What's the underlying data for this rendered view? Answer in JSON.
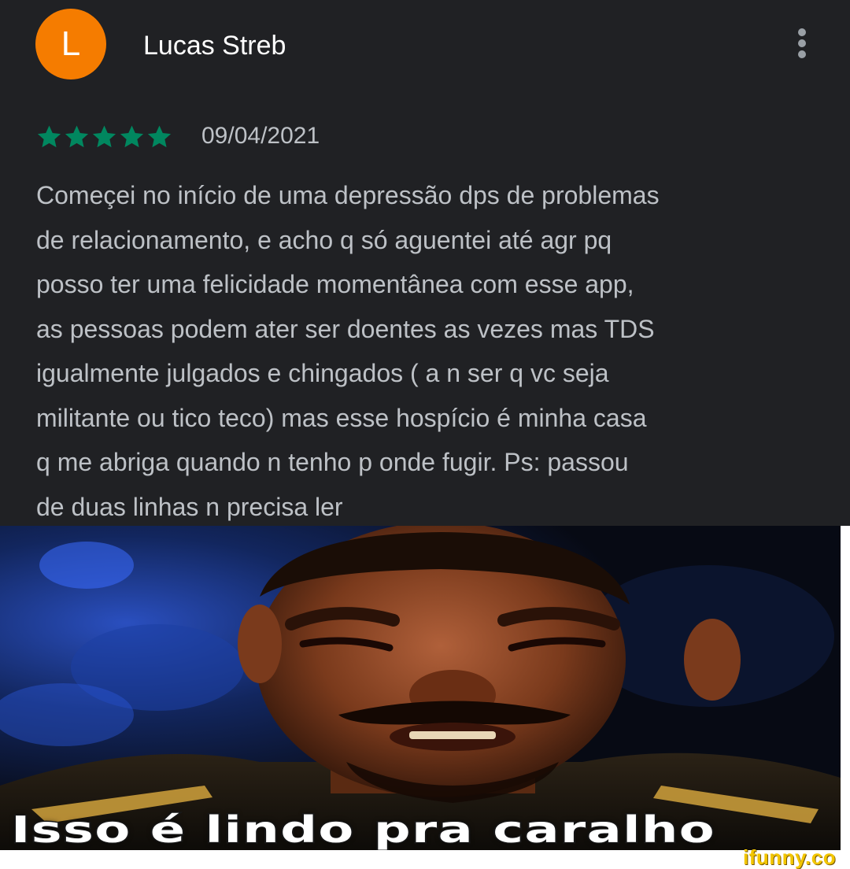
{
  "review": {
    "author_initial": "L",
    "author_name": "Lucas Streb",
    "more_icon": "more-vertical-icon",
    "rating": 5,
    "rating_max": 5,
    "star_icon": "star-icon",
    "date": "09/04/2021",
    "text_lines": [
      "Começei no início de uma depressão dps de problemas",
      "de relacionamento, e acho q só aguentei até agr pq",
      "posso ter uma felicidade momentânea com esse app,",
      "as pessoas podem ater ser doentes as vezes mas TDS",
      "igualmente julgados e chingados ( a n ser q vc seja",
      "militante ou tico teco) mas esse hospício é minha casa",
      "q me abriga quando n tenho p onde fugir. Ps: passou",
      "de duas linhas n precisa ler"
    ]
  },
  "meme": {
    "caption": "Isso é lindo pra caralho",
    "watermark": "ifunny.co"
  },
  "colors": {
    "card_background": "#202124",
    "avatar": "#f57c00",
    "star": "#01875f",
    "text_primary": "#ffffff",
    "text_secondary": "#bdc1c6",
    "watermark": "#f3c600"
  }
}
